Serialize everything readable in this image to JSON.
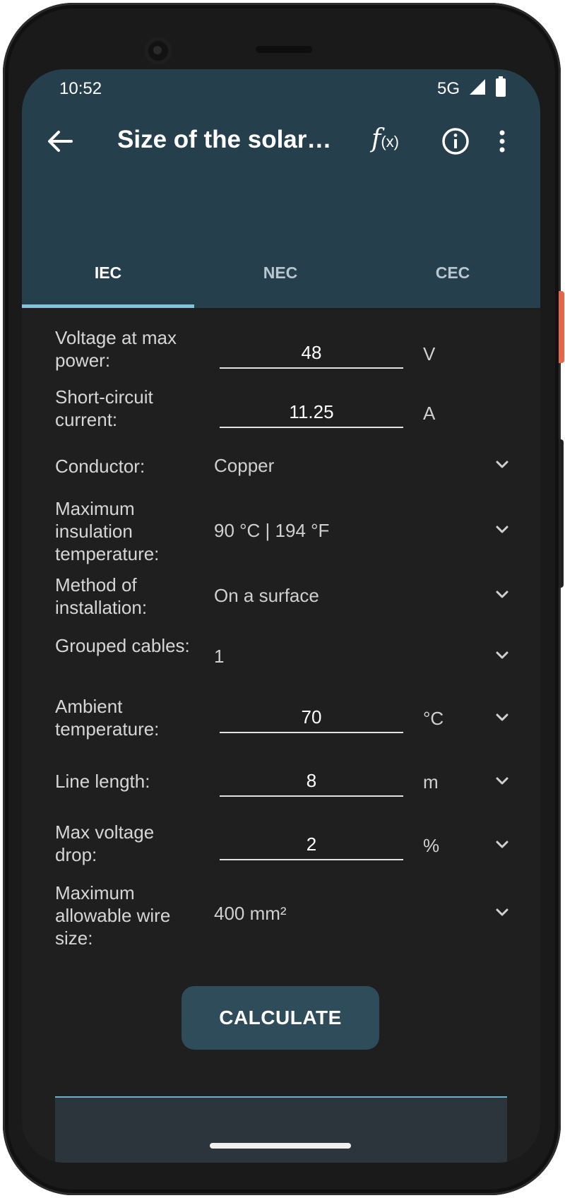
{
  "status_bar": {
    "time": "10:52",
    "network": "5G"
  },
  "toolbar": {
    "title": "Size of the solar…",
    "fx_main": "f",
    "fx_sub": "(x)"
  },
  "tabs": [
    {
      "label": "IEC"
    },
    {
      "label": "NEC"
    },
    {
      "label": "CEC"
    }
  ],
  "form": {
    "voltage": {
      "label": "Voltage at max power:",
      "value": "48",
      "unit": "V"
    },
    "current": {
      "label": "Short-circuit current:",
      "value": "11.25",
      "unit": "A"
    },
    "conductor": {
      "label": "Conductor:",
      "value": "Copper"
    },
    "insulation": {
      "label": "Maximum insulation temperature:",
      "value": "90 °C | 194 °F"
    },
    "installation": {
      "label": "Method of installation:",
      "value": "On a surface"
    },
    "grouped": {
      "label": "Grouped cables:",
      "value": "1"
    },
    "ambient": {
      "label": "Ambient temperature:",
      "value": "70",
      "unit": "°C"
    },
    "length": {
      "label": "Line length:",
      "value": "8",
      "unit": "m"
    },
    "drop": {
      "label": "Max voltage drop:",
      "value": "2",
      "unit": "%"
    },
    "wire_size": {
      "label": "Maximum allowable wire size:",
      "value": "400 mm²"
    }
  },
  "calculate_label": "CALCULATE",
  "colors": {
    "app_bar": "#263f4c",
    "background": "#1f1f1f",
    "tab_indicator": "#7ec6d9",
    "button": "#2e4c5a"
  },
  "icons": {
    "back": "arrow-left-icon",
    "formula": "function-icon",
    "info": "info-icon",
    "more": "more-vert-icon",
    "dropdown": "chevron-down-icon"
  }
}
